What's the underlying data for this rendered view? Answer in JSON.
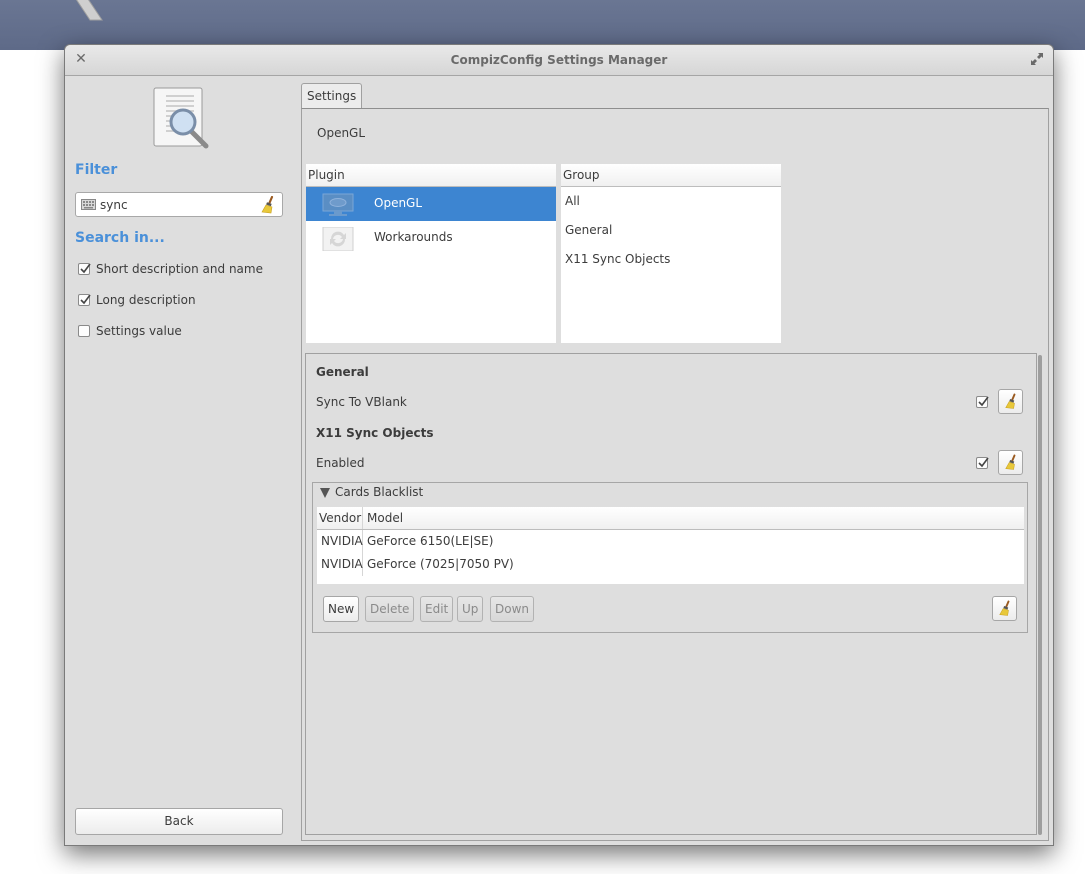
{
  "window": {
    "title": "CompizConfig Settings Manager",
    "close_icon": "close-icon",
    "maximize_icon": "maximize-icon"
  },
  "left": {
    "filter_heading": "Filter",
    "filter_value": "sync",
    "filter_placeholder": "",
    "search_in_heading": "Search in...",
    "options": [
      {
        "label": "Short description and name",
        "checked": true
      },
      {
        "label": "Long description",
        "checked": true
      },
      {
        "label": "Settings value",
        "checked": false
      }
    ],
    "back_label": "Back"
  },
  "main": {
    "tab_label": "Settings",
    "plugin_heading": "OpenGL",
    "plugin_list": {
      "header": "Plugin",
      "items": [
        {
          "name": "OpenGL",
          "icon": "monitor-icon",
          "selected": true
        },
        {
          "name": "Workarounds",
          "icon": "refresh-icon",
          "selected": false
        }
      ]
    },
    "group_list": {
      "header": "Group",
      "items": [
        "All",
        "General",
        "X11 Sync Objects"
      ]
    },
    "settings": {
      "groups": [
        {
          "title": "General",
          "items": [
            {
              "label": "Sync To VBlank",
              "checked": true
            }
          ]
        },
        {
          "title": "X11 Sync Objects",
          "items": [
            {
              "label": "Enabled",
              "checked": true
            }
          ]
        }
      ],
      "blacklist": {
        "title": "Cards Blacklist",
        "columns": [
          "Vendor",
          "Model"
        ],
        "rows": [
          [
            "NVIDIA",
            "GeForce 6150(LE|SE)"
          ],
          [
            "NVIDIA",
            "GeForce (7025|7050 PV)"
          ]
        ],
        "buttons": [
          {
            "label": "New",
            "enabled": true
          },
          {
            "label": "Delete",
            "enabled": false
          },
          {
            "label": "Edit",
            "enabled": false
          },
          {
            "label": "Up",
            "enabled": false
          },
          {
            "label": "Down",
            "enabled": false
          }
        ]
      }
    }
  },
  "colors": {
    "accent": "#4a90d9",
    "selection": "#3d85d1"
  }
}
